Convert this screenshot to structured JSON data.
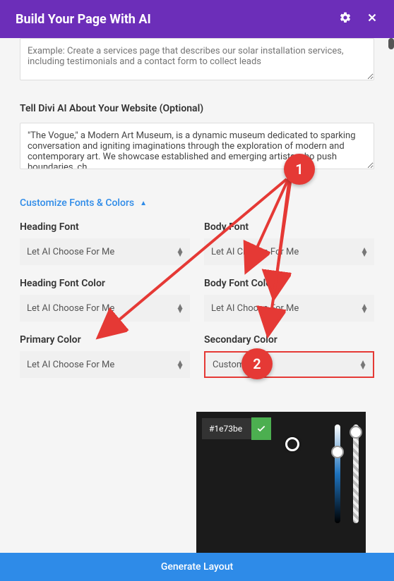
{
  "header": {
    "title": "Build Your Page With AI"
  },
  "prompt_example": "Example: Create a services page that describes our solar installation services, including testimonials and a contact form to collect leads",
  "about_label": "Tell Divi AI About Your Website (Optional)",
  "about_value": "\"The Vogue,\" a Modern Art Museum, is a dynamic museum dedicated to sparking conversation and igniting imaginations through the exploration of modern and contemporary art. We showcase established and emerging artists who push boundaries, ch",
  "customize_label": "Customize Fonts & Colors",
  "fields": {
    "heading_font": {
      "label": "Heading Font",
      "value": "Let AI Choose For Me"
    },
    "body_font": {
      "label": "Body Font",
      "value": "Let AI Choose For Me"
    },
    "heading_font_color": {
      "label": "Heading Font Color",
      "value": "Let AI Choose For Me"
    },
    "body_font_color": {
      "label": "Body Font Color",
      "value": "Let AI Choose For Me"
    },
    "primary_color": {
      "label": "Primary Color",
      "value": "Let AI Choose For Me"
    },
    "secondary_color": {
      "label": "Secondary Color",
      "value": "Custom"
    }
  },
  "colorpicker": {
    "hex": "#1e73be"
  },
  "footer": {
    "generate": "Generate Layout"
  },
  "annotations": {
    "one": "1",
    "two": "2"
  }
}
